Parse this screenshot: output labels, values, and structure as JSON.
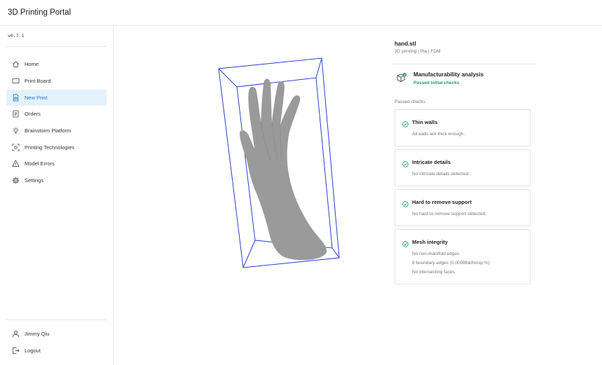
{
  "app": {
    "title": "3D Printing Portal",
    "version": "v0.7.1"
  },
  "sidebar": {
    "items": [
      {
        "label": "Home",
        "icon": "home-icon",
        "active": false
      },
      {
        "label": "Print Board",
        "icon": "board-icon",
        "active": false
      },
      {
        "label": "New Print",
        "icon": "new-file-icon",
        "active": true
      },
      {
        "label": "Orders",
        "icon": "orders-icon",
        "active": false
      },
      {
        "label": "Brainstorm Platform",
        "icon": "lightbulb-icon",
        "active": false
      },
      {
        "label": "Printing Technologies",
        "icon": "scan-icon",
        "active": false
      },
      {
        "label": "Model Errors",
        "icon": "warning-icon",
        "active": false
      },
      {
        "label": "Settings",
        "icon": "gear-icon",
        "active": false
      }
    ],
    "user": {
      "name": "Jimmy Qiu",
      "icon": "user-icon"
    },
    "logout": {
      "label": "Logout",
      "icon": "logout-icon"
    }
  },
  "file": {
    "name": "hand.stl",
    "meta": "3D printing  | Pla | FDM"
  },
  "analysis": {
    "title": "Manufacturability analysis",
    "status": "Passed initial checks",
    "icon": "cube-check-icon"
  },
  "checks": {
    "label": "Passed checks",
    "items": [
      {
        "title": "Thin walls",
        "lines": [
          "All walls are thick enough."
        ]
      },
      {
        "title": "Intricate details",
        "lines": [
          "No intricate details detected."
        ]
      },
      {
        "title": "Hard to remove support",
        "lines": [
          "No hard to remove support detected."
        ]
      },
      {
        "title": "Mesh integrity",
        "lines": [
          "No non-manifold edges",
          "8 boundary edges (0.00088&thinsp;%)",
          "No intersecting faces"
        ]
      }
    ]
  },
  "colors": {
    "accent": "#2a74c6",
    "active_bg": "#e3f1fb",
    "success": "#22a06b",
    "box": "#2a3fd6",
    "model": "#9a9a9a"
  }
}
